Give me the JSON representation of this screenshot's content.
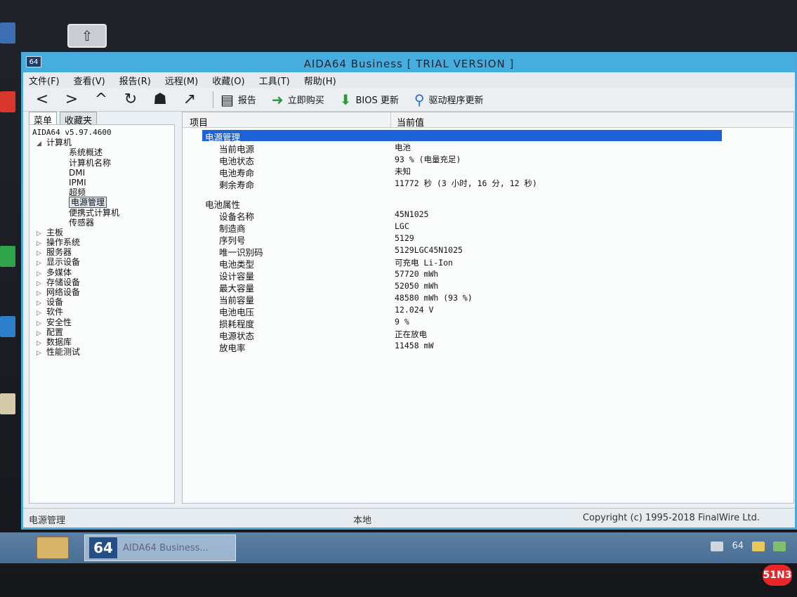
{
  "window": {
    "icon_label": "64",
    "title": "AIDA64 Business  [ TRIAL VERSION ]"
  },
  "menu": [
    "文件(F)",
    "查看(V)",
    "报告(R)",
    "远程(M)",
    "收藏(O)",
    "工具(T)",
    "帮助(H)"
  ],
  "toolbar": {
    "nav_icons": [
      "back-arrow-icon",
      "forward-arrow-icon",
      "up-arrow-icon",
      "refresh-icon",
      "users-icon",
      "chart-icon"
    ],
    "buttons": [
      {
        "label": "报告",
        "icon": "report-icon"
      },
      {
        "label": "立即购买",
        "icon": "buy-icon"
      },
      {
        "label": "BIOS 更新",
        "icon": "download-icon"
      },
      {
        "label": "驱动程序更新",
        "icon": "search-icon"
      }
    ]
  },
  "left_tabs": [
    "菜单",
    "收藏夹"
  ],
  "tree": {
    "root": "AIDA64 v5.97.4600",
    "computer": "计算机",
    "computer_children": [
      "系统概述",
      "计算机名称",
      "DMI",
      "IPMI",
      "超频",
      "电源管理",
      "便携式计算机",
      "传感器"
    ],
    "selected": "电源管理",
    "top_level": [
      "主板",
      "操作系统",
      "服务器",
      "显示设备",
      "多媒体",
      "存储设备",
      "网络设备",
      "设备",
      "软件",
      "安全性",
      "配置",
      "数据库",
      "性能测试"
    ]
  },
  "content": {
    "col_item": "项目",
    "col_value": "当前值",
    "rows": [
      {
        "type": "group",
        "key": "电源管理",
        "value": ""
      },
      {
        "type": "item",
        "key": "当前电源",
        "value": "电池"
      },
      {
        "type": "item",
        "key": "电池状态",
        "value": "93 % (电量充足)"
      },
      {
        "type": "item",
        "key": "电池寿命",
        "value": "未知"
      },
      {
        "type": "item",
        "key": "剩余寿命",
        "value": "11772 秒 (3 小时, 16 分, 12 秒)"
      },
      {
        "type": "spacer",
        "key": "",
        "value": ""
      },
      {
        "type": "group",
        "key": "电池属性",
        "value": ""
      },
      {
        "type": "item",
        "key": "设备名称",
        "value": "45N1025"
      },
      {
        "type": "item",
        "key": "制造商",
        "value": "LGC"
      },
      {
        "type": "item",
        "key": "序列号",
        "value": "5129"
      },
      {
        "type": "item",
        "key": "唯一识别码",
        "value": "5129LGC45N1025"
      },
      {
        "type": "item",
        "key": "电池类型",
        "value": "可充电 Li-Ion"
      },
      {
        "type": "item",
        "key": "设计容量",
        "value": "57720 mWh"
      },
      {
        "type": "item",
        "key": "最大容量",
        "value": "52050 mWh"
      },
      {
        "type": "item",
        "key": "当前容量",
        "value": "48580 mWh  (93 %)"
      },
      {
        "type": "item",
        "key": "电池电压",
        "value": "12.024 V"
      },
      {
        "type": "item",
        "key": "损耗程度",
        "value": "9 %"
      },
      {
        "type": "item",
        "key": "电源状态",
        "value": "正在放电"
      },
      {
        "type": "item",
        "key": "放电率",
        "value": "11458 mW"
      }
    ]
  },
  "status": {
    "left": "电源管理",
    "middle": "本地",
    "right": "Copyright (c) 1995-2018 FinalWire Ltd."
  },
  "taskbar": {
    "app_icon_label": "64",
    "app_label": "AIDA64 Business...",
    "tray_label": "64"
  },
  "watermark": "51N3",
  "colors": {
    "titlebar": "#46aede",
    "selection": "#1e62d8",
    "taskbar": "#4a6f95"
  }
}
